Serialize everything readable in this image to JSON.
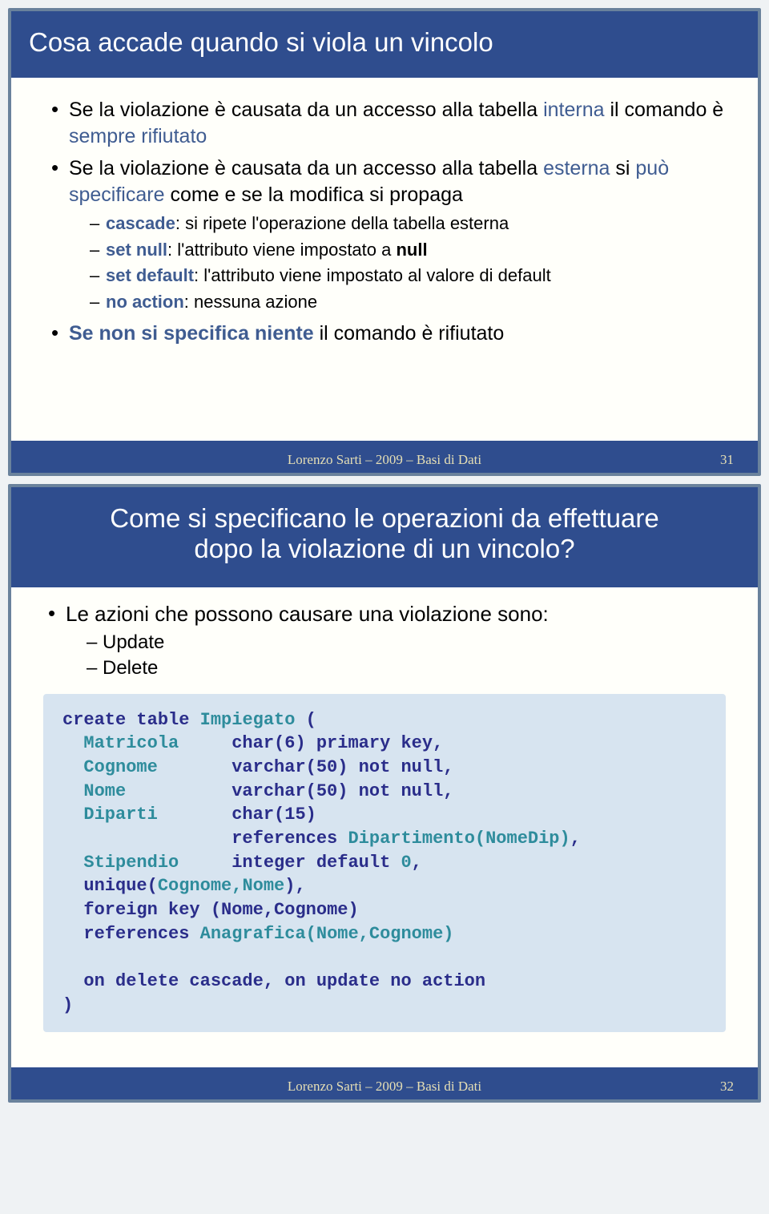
{
  "slide1": {
    "title": "Cosa accade quando si viola un vincolo",
    "b1_a": "Se la violazione è causata da un accesso alla tabella ",
    "b1_b": "interna",
    "b1_c": " il comando è ",
    "b1_d": "sempre rifiutato",
    "b2_a": "Se la violazione è causata da un accesso alla tabella ",
    "b2_b": "esterna",
    "b2_c": " si ",
    "b2_d": "può specificare",
    "b2_e": " come e se la modifica si propaga",
    "s1_a": "cascade",
    "s1_b": ": si ripete l'operazione della tabella esterna",
    "s2_a": "set null",
    "s2_b": ": l'attributo viene impostato a ",
    "s2_c": "null",
    "s3_a": "set default",
    "s3_b": ": l'attributo viene impostato al valore di default",
    "s4_a": "no action",
    "s4_b": ": nessuna azione",
    "b3_a": "Se non si specifica niente",
    "b3_b": " il comando è rifiutato",
    "footer": "Lorenzo Sarti – 2009 – Basi di Dati",
    "page": "31"
  },
  "slide2": {
    "title_l1": "Come si specificano le operazioni da effettuare",
    "title_l2": "dopo la violazione di un vincolo?",
    "b1": "Le azioni che possono causare una violazione sono:",
    "s1": "Update",
    "s2": "Delete",
    "code": {
      "l1a": "create table ",
      "l1b": "Impiegato ",
      "l1c": "(",
      "l2a": "  Matricola     ",
      "l2b": "char(6) primary key,",
      "l3a": "  Cognome       ",
      "l3b": "varchar(50) not null,",
      "l4a": "  Nome          ",
      "l4b": "varchar(50) not null,",
      "l5a": "  Diparti       ",
      "l5b": "char(15)",
      "l6a": "                ",
      "l6b": "references ",
      "l6c": "Dipartimento(NomeDip)",
      "l6d": ",",
      "l7a": "  Stipendio     ",
      "l7b": "integer default ",
      "l7c": "0",
      "l7d": ",",
      "l8a": "  ",
      "l8b": "unique(",
      "l8c": "Cognome,Nome",
      "l8d": "),",
      "l9a": "  ",
      "l9b": "foreign key ",
      "l9c": "(Nome,Cognome)",
      "l10a": "  ",
      "l10b": "references ",
      "l10c": "Anagrafica(Nome,Cognome)",
      "l11": "  on delete cascade, on update no action",
      "l12": ")"
    },
    "footer": "Lorenzo Sarti – 2009 – Basi di Dati",
    "page": "32"
  }
}
